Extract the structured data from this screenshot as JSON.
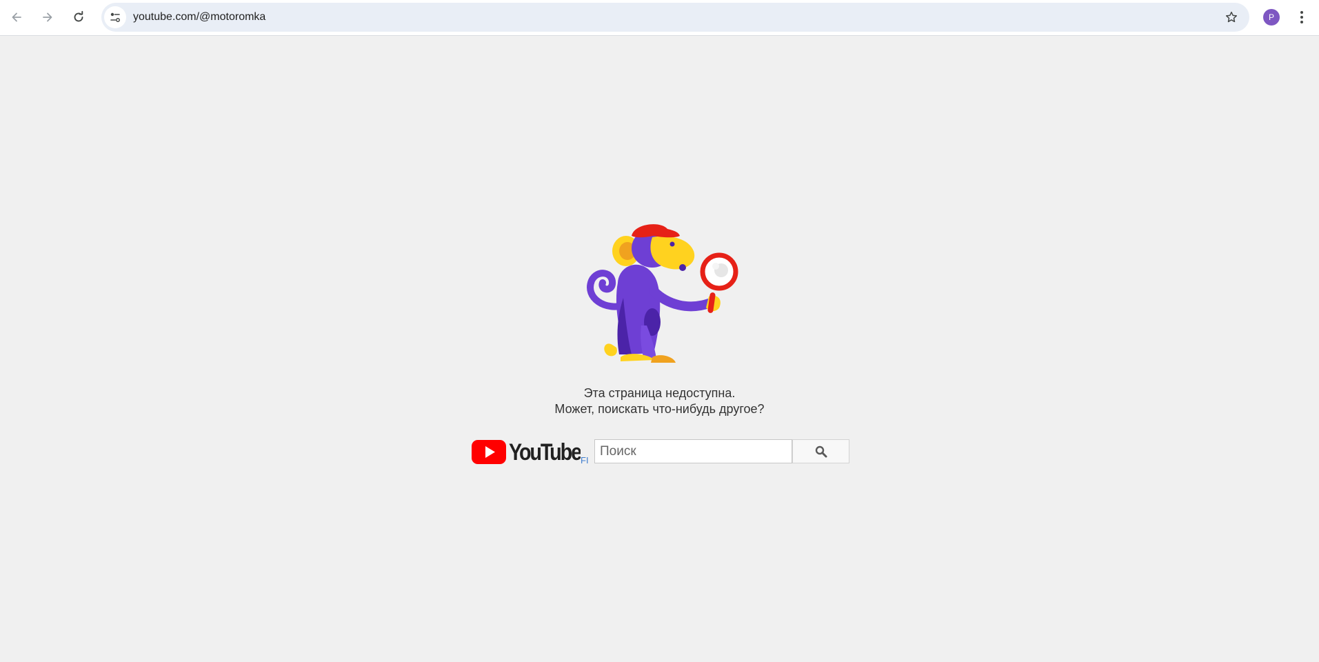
{
  "browser": {
    "url": "youtube.com/@motoromka",
    "profile_initial": "P",
    "icons": {
      "back": "back-arrow-icon",
      "forward": "forward-arrow-icon",
      "reload": "reload-icon",
      "site_info": "site-settings-icon",
      "bookmark": "star-icon",
      "menu": "more-vert-icon"
    }
  },
  "page": {
    "message_line1": "Эта страница недоступна.",
    "message_line2": "Может, поискать что-нибудь другое?",
    "logo_region": "FI",
    "search_placeholder": "Поиск",
    "illustration": "monkey-with-magnifying-glass",
    "colors": {
      "background": "#f0f0f0",
      "youtube_red": "#ff0000",
      "monkey_purple": "#6e3fd4",
      "monkey_yellow": "#ffd21f"
    }
  }
}
